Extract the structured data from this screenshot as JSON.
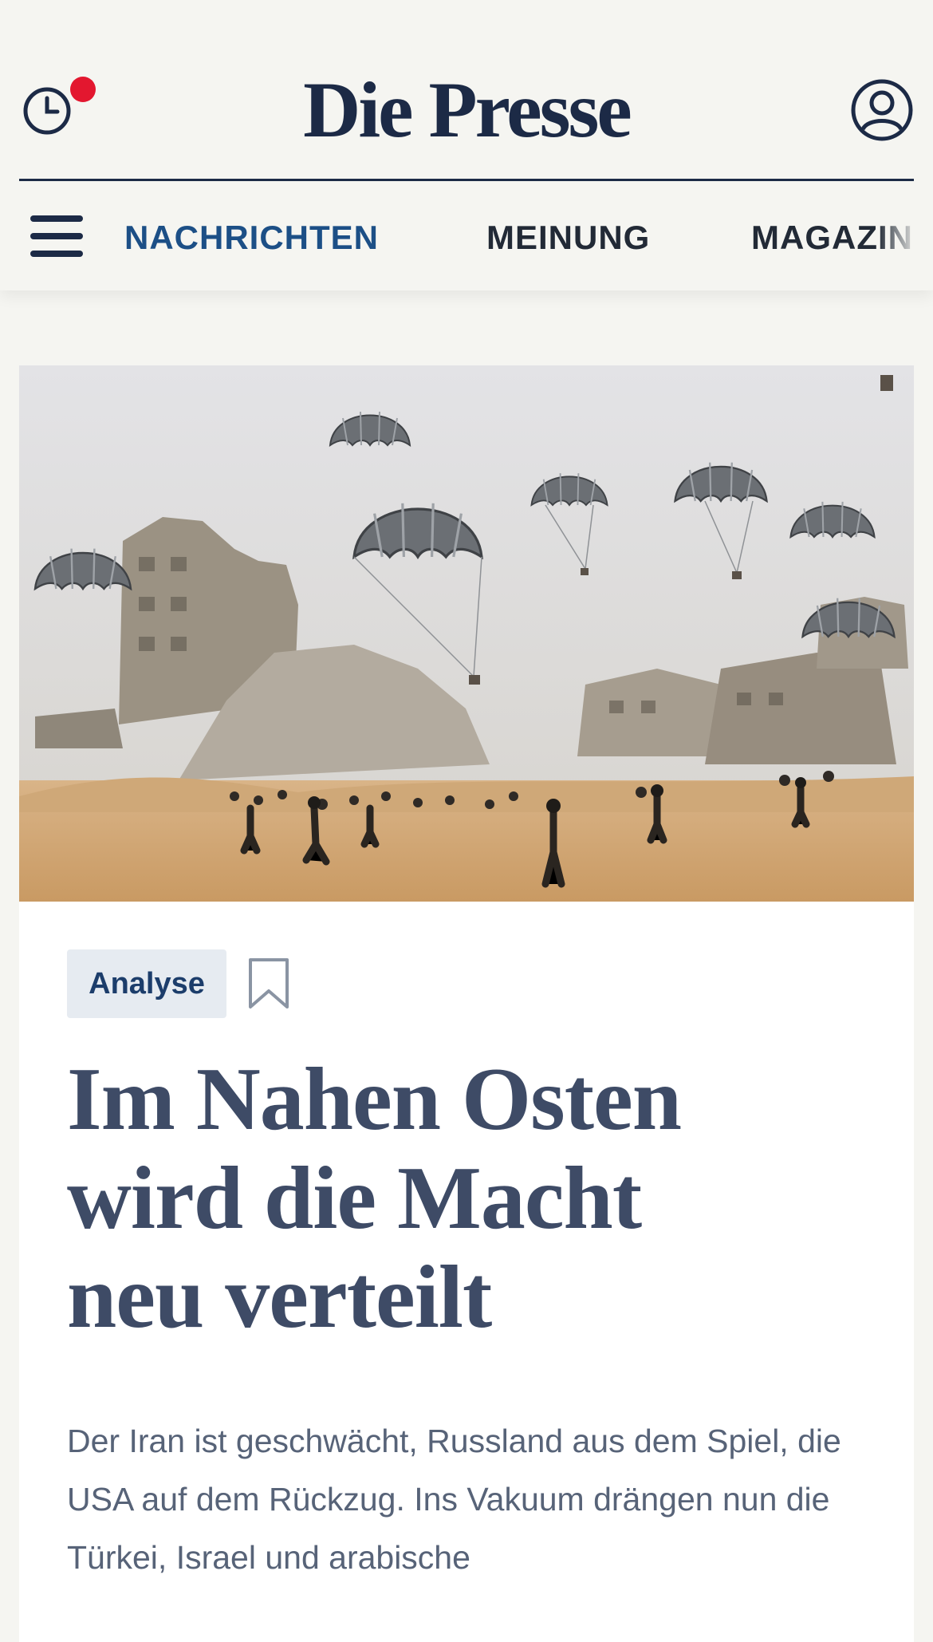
{
  "header": {
    "logo": "Die Presse",
    "nav": [
      {
        "label": "NACHRICHTEN",
        "active": true
      },
      {
        "label": "MEINUNG",
        "active": false
      },
      {
        "label": "MAGAZIN",
        "active": false
      }
    ]
  },
  "article": {
    "tag": "Analyse",
    "headline_lines": [
      "Im Nahen Osten",
      "wird die Macht",
      "neu verteilt"
    ],
    "teaser": "Der Iran ist geschwächt, Russland aus dem Spiel, die USA auf dem Rückzug. Ins Vakuum drängen nun die Türkei, Israel und arabische"
  },
  "colors": {
    "brand": "#1c2a46",
    "active_nav": "#1c4f86",
    "notification": "#e3172f",
    "headline": "#3e4b66",
    "badge_bg": "#e6ebf1"
  },
  "icons": {
    "history": "clock-icon",
    "account": "user-icon",
    "menu": "hamburger-icon",
    "save": "bookmark-icon"
  }
}
